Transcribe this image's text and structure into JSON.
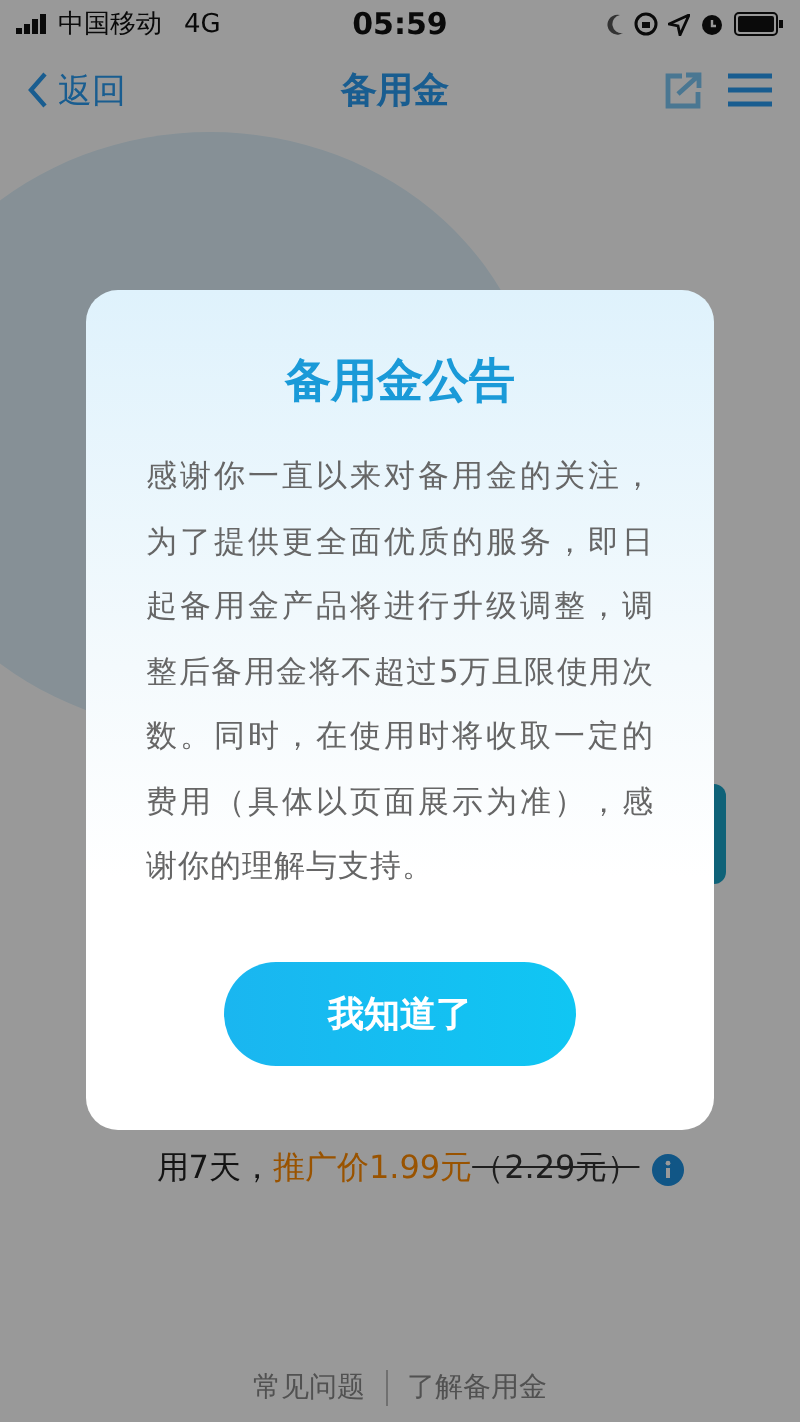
{
  "status_bar": {
    "carrier": "中国移动",
    "network": "4G",
    "time": "05:59"
  },
  "nav_bar": {
    "back": "返回",
    "title": "备用金"
  },
  "page": {
    "fee_note": {
      "prefix": "用7天，",
      "promo": "推广价1.99元",
      "original": "（2.29元）"
    },
    "footer_links": [
      "常见问题",
      "了解备用金"
    ]
  },
  "dialog": {
    "title": "备用金公告",
    "body": "感谢你一直以来对备用金的关注，为了提供更全面优质的服务，即日起备用金产品将进行升级调整，调整后备用金将不超过5万且限使用次数。同时，在使用时将收取一定的费用（具体以页面展示为准），感谢你的理解与支持。",
    "button": "我知道了"
  }
}
